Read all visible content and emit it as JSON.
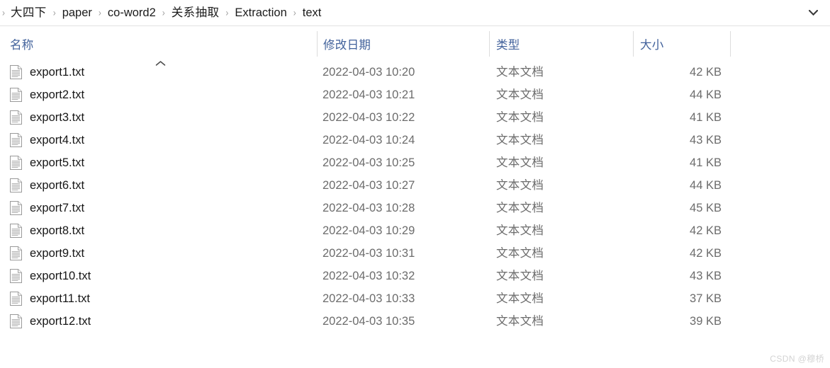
{
  "address_bar": {
    "leading_separator": "›",
    "separator": "›",
    "crumbs": [
      {
        "label": "大四下",
        "cjk": true
      },
      {
        "label": "paper",
        "cjk": false
      },
      {
        "label": "co-word2",
        "cjk": false
      },
      {
        "label": "关系抽取",
        "cjk": true
      },
      {
        "label": "Extraction",
        "cjk": false
      },
      {
        "label": "text",
        "cjk": false
      }
    ],
    "chevron_icon": "chevron-down-icon"
  },
  "columns": {
    "name": "名称",
    "date_modified": "修改日期",
    "type": "类型",
    "size": "大小",
    "sort_indicator": "ascending",
    "header_color": "#41619b"
  },
  "files": [
    {
      "name": "export1.txt",
      "date": "2022-04-03 10:20",
      "type": "文本文档",
      "size": "42 KB",
      "icon": "text-file-icon"
    },
    {
      "name": "export2.txt",
      "date": "2022-04-03 10:21",
      "type": "文本文档",
      "size": "44 KB",
      "icon": "text-file-icon"
    },
    {
      "name": "export3.txt",
      "date": "2022-04-03 10:22",
      "type": "文本文档",
      "size": "41 KB",
      "icon": "text-file-icon"
    },
    {
      "name": "export4.txt",
      "date": "2022-04-03 10:24",
      "type": "文本文档",
      "size": "43 KB",
      "icon": "text-file-icon"
    },
    {
      "name": "export5.txt",
      "date": "2022-04-03 10:25",
      "type": "文本文档",
      "size": "41 KB",
      "icon": "text-file-icon"
    },
    {
      "name": "export6.txt",
      "date": "2022-04-03 10:27",
      "type": "文本文档",
      "size": "44 KB",
      "icon": "text-file-icon"
    },
    {
      "name": "export7.txt",
      "date": "2022-04-03 10:28",
      "type": "文本文档",
      "size": "45 KB",
      "icon": "text-file-icon"
    },
    {
      "name": "export8.txt",
      "date": "2022-04-03 10:29",
      "type": "文本文档",
      "size": "42 KB",
      "icon": "text-file-icon"
    },
    {
      "name": "export9.txt",
      "date": "2022-04-03 10:31",
      "type": "文本文档",
      "size": "42 KB",
      "icon": "text-file-icon"
    },
    {
      "name": "export10.txt",
      "date": "2022-04-03 10:32",
      "type": "文本文档",
      "size": "43 KB",
      "icon": "text-file-icon"
    },
    {
      "name": "export11.txt",
      "date": "2022-04-03 10:33",
      "type": "文本文档",
      "size": "37 KB",
      "icon": "text-file-icon"
    },
    {
      "name": "export12.txt",
      "date": "2022-04-03 10:35",
      "type": "文本文档",
      "size": "39 KB",
      "icon": "text-file-icon"
    }
  ],
  "watermark": {
    "text": "CSDN @穆桥"
  }
}
